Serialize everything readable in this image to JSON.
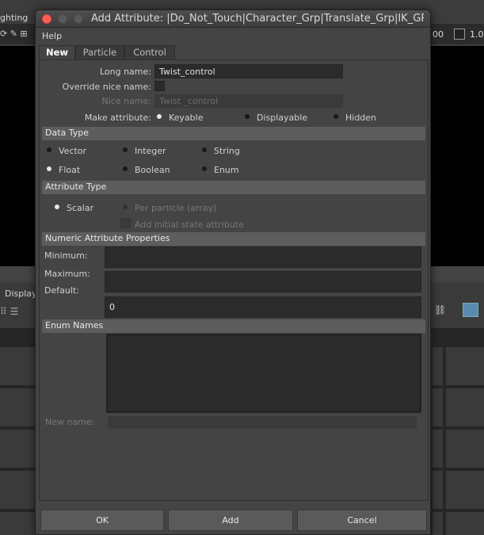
{
  "background": {
    "top_label": "ghting",
    "top_right_value1": "00",
    "top_right_value2": "1.0",
    "display_label": "Display"
  },
  "dialog": {
    "title": "Add Attribute: |Do_Not_Touch|Character_Grp|Translate_Grp|IK_GRP|l_f...",
    "menu": {
      "help": "Help"
    },
    "tabs": [
      {
        "label": "New",
        "active": true
      },
      {
        "label": "Particle",
        "active": false
      },
      {
        "label": "Control",
        "active": false
      }
    ],
    "long_name": {
      "label": "Long name:",
      "value": "Twist_control"
    },
    "override_nice_name": {
      "label": "Override nice name:",
      "checked": false
    },
    "nice_name": {
      "label": "Nice name:",
      "value": "Twist _control"
    },
    "make_attribute": {
      "label": "Make attribute:",
      "options": [
        "Keyable",
        "Displayable",
        "Hidden"
      ],
      "selected": "Keyable"
    },
    "data_type": {
      "header": "Data Type",
      "options": [
        "Vector",
        "Integer",
        "String",
        "Float",
        "Boolean",
        "Enum"
      ],
      "selected": "Float"
    },
    "attribute_type": {
      "header": "Attribute Type",
      "scalar": "Scalar",
      "per_particle": "Per particle (array)",
      "initial_state": "Add initial state attribute",
      "selected": "Scalar"
    },
    "numeric_properties": {
      "header": "Numeric Attribute Properties",
      "minimum_label": "Minimum:",
      "maximum_label": "Maximum:",
      "default_label": "Default:",
      "minimum_value": "",
      "maximum_value": "",
      "default_value": "0"
    },
    "enum_names": {
      "header": "Enum Names",
      "new_name_label": "New name:"
    },
    "buttons": {
      "ok": "OK",
      "add": "Add",
      "cancel": "Cancel"
    }
  }
}
